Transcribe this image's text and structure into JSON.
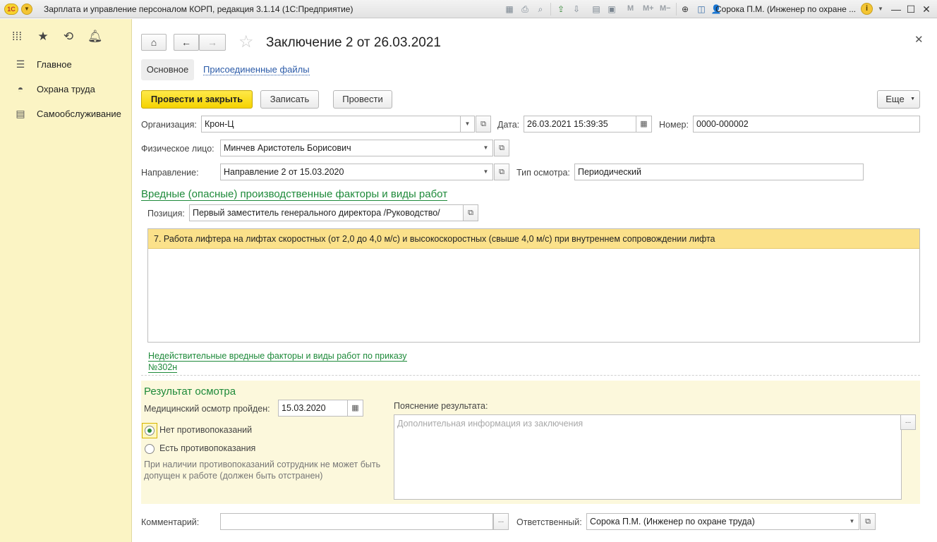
{
  "window": {
    "app_title": "Зарплата и управление персоналом КОРП, редакция 3.1.14 (1С:Предприятие)",
    "logo": "1С",
    "toolbar_icons": [
      "save-icon",
      "print-icon",
      "preview-icon",
      "upload-icon",
      "download-icon",
      "calculator-icon",
      "calendar-icon",
      "m-icon",
      "m-plus-icon",
      "m-minus-icon",
      "zoom-icon",
      "panel-icon"
    ],
    "m_labels": [
      "M",
      "M+",
      "M−"
    ],
    "user": "Сорока П.М. (Инженер по охране ...",
    "info": "i"
  },
  "sidebar": {
    "items": [
      {
        "label": "Главное",
        "icon": "menu-lines-icon"
      },
      {
        "label": "Охрана труда",
        "icon": "helmet-icon"
      },
      {
        "label": "Самообслуживание",
        "icon": "id-card-icon"
      }
    ]
  },
  "header": {
    "title": "Заключение 2 от 26.03.2021",
    "tabs": {
      "main": "Основное",
      "files": "Присоединенные файлы"
    }
  },
  "actions": {
    "post_close": "Провести и закрыть",
    "save": "Записать",
    "post": "Провести",
    "more": "Еще"
  },
  "form": {
    "organization_label": "Организация:",
    "organization_value": "Крон-Ц",
    "date_label": "Дата:",
    "date_value": "26.03.2021 15:39:35",
    "number_label": "Номер:",
    "number_value": "0000-000002",
    "person_label": "Физическое лицо:",
    "person_value": "Минчев Аристотель Борисович",
    "direction_label": "Направление:",
    "direction_value": "Направление 2 от 15.03.2020",
    "exam_type_label": "Тип осмотра:",
    "exam_type_value": "Периодический"
  },
  "factors": {
    "section_title": "Вредные (опасные) производственные факторы и виды работ",
    "position_label": "Позиция:",
    "position_value": "Первый заместитель генерального директора /Руководство/",
    "rows": [
      "7. Работа лифтера на лифтах скоростных (от 2,0 до 4,0 м/с) и высокоскоростных (свыше 4,0 м/с) при внутреннем сопровождении лифта"
    ],
    "invalid_link_line1": "Недействительные вредные факторы и виды работ по приказу",
    "invalid_link_line2": "№302н"
  },
  "result": {
    "title": "Результат осмотра",
    "passed_label": "Медицинский осмотр пройден:",
    "passed_date": "15.03.2020",
    "option_no": "Нет противопоказаний",
    "option_yes": "Есть противопоказания",
    "selected": "option_no",
    "note": "При наличии противопоказаний сотрудник не может быть допущен к работе (должен быть отстранен)",
    "explanation_label": "Пояснение результата:",
    "explanation_placeholder": "Дополнительная информация из заключения"
  },
  "footer": {
    "comment_label": "Комментарий:",
    "comment_value": "",
    "responsible_label": "Ответственный:",
    "responsible_value": "Сорока П.М. (Инженер по охране труда)"
  },
  "colors": {
    "sidebar_bg": "#fbf4c4",
    "primary_button": "#f5d300",
    "link_green": "#1e8a3a",
    "link_blue": "#2a5aa8",
    "row_highlight": "#fbe18a",
    "result_panel_bg": "#fcf8dc"
  }
}
